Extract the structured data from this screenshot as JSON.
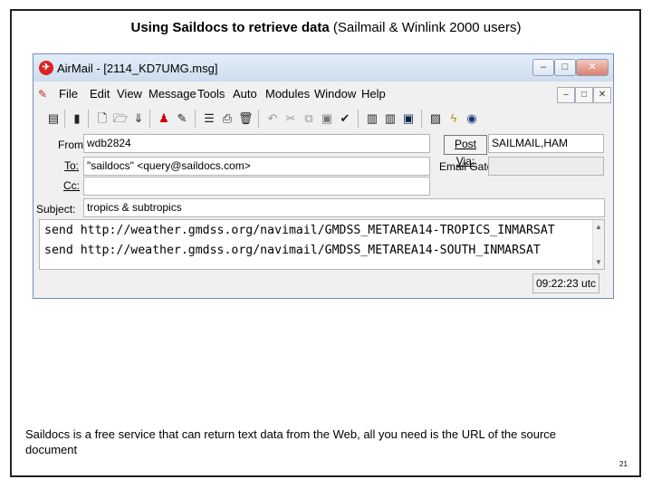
{
  "slide": {
    "title_bold": "Using Saildocs to retrieve data",
    "title_rest": " (Sailmail & Winlink 2000 users)",
    "caption": "Saildocs is a free service that can return text data from the Web, all you need is the URL of the source document",
    "page_number": "21"
  },
  "window": {
    "title": "AirMail - [2114_KD7UMG.msg]",
    "minimize": "–",
    "restore": "□",
    "close": "✕"
  },
  "menu": [
    "File",
    "Edit",
    "View",
    "Message",
    "Tools",
    "Auto",
    "Modules",
    "Window",
    "Help"
  ],
  "mdi_buttons": [
    "–",
    "□",
    "✕"
  ],
  "toolbar_icons": [
    "form-icon",
    "pencil-icon",
    "new-doc-icon",
    "open-folder-icon",
    "save-icon",
    "attach-icon",
    "send-icon",
    "hat-icon",
    "align-left-icon",
    "print-icon",
    "delete-icon",
    "undo-icon",
    "cut-icon",
    "copy-icon",
    "paste-icon",
    "spellcheck-icon",
    "list1-icon",
    "list2-icon",
    "list3-icon",
    "image-icon",
    "lightning-icon",
    "globe-icon"
  ],
  "form": {
    "from_label": "From:",
    "from_value": "wdb2824",
    "to_label": "To:",
    "to_value": "\"saildocs\" <query@saildocs.com>",
    "cc_label": "Cc:",
    "cc_value": "",
    "subject_label": "Subject:",
    "subject_value": "tropics & subtropics",
    "postvia_label": "Post Via:",
    "postvia_value": "SAILMAIL,HAM",
    "emailgate_label": "Email Gate:",
    "emailgate_value": ""
  },
  "body_lines": [
    "send http://weather.gmdss.org/navimail/GMDSS_METAREA14-TROPICS_INMARSAT",
    "send http://weather.gmdss.org/navimail/GMDSS_METAREA14-SOUTH_INMARSAT"
  ],
  "status_time": "09:22:23 utc"
}
